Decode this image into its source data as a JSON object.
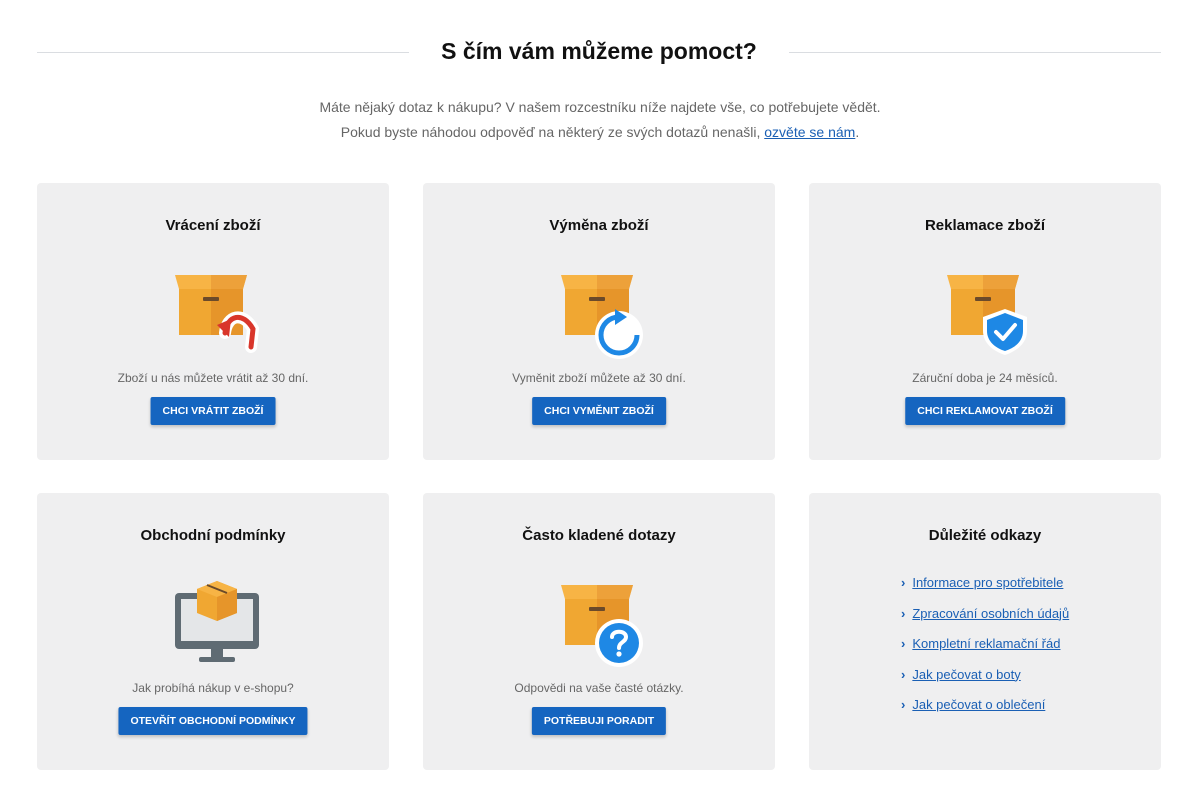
{
  "header": {
    "title": "S čím vám můžeme pomoct?"
  },
  "intro": {
    "line1": "Máte nějaký dotaz k nákupu? V našem rozcestníku níže najdete vše, co potřebujete vědět.",
    "line2_prefix": "Pokud byste náhodou odpověď na některý ze svých dotazů nenašli,",
    "line2_link": "ozvěte se nám",
    "line2_suffix": "."
  },
  "cards": [
    {
      "title": "Vrácení zboží",
      "text": "Zboží u nás můžete vrátit až 30 dní.",
      "button": "Chci vrátit zboží",
      "icon": "box-return-icon"
    },
    {
      "title": "Výměna zboží",
      "text": "Vyměnit zboží můžete až 30 dní.",
      "button": "Chci vyměnit zboží",
      "icon": "box-exchange-icon"
    },
    {
      "title": "Reklamace zboží",
      "text": "Záruční doba je 24 měsíců.",
      "button": "Chci reklamovat zboží",
      "icon": "box-shield-icon"
    },
    {
      "title": "Obchodní podmínky",
      "text": "Jak probíhá nákup v e-shopu?",
      "button": "Otevřít obchodní podmínky",
      "icon": "monitor-box-icon"
    },
    {
      "title": "Často kladené dotazy",
      "text": "Odpovědi na vaše časté otázky.",
      "button": "Potřebuji poradit",
      "icon": "box-question-icon"
    }
  ],
  "links_card": {
    "title": "Důležité odkazy",
    "items": [
      "Informace pro spotřebitele",
      "Zpracování osobních údajů",
      "Kompletní reklamační řád",
      "Jak pečovat o boty",
      "Jak pečovat o oblečení"
    ]
  },
  "colors": {
    "button": "#1565c0",
    "link": "#1a5fb4",
    "card_bg": "#efeff0",
    "box_orange": "#f5a623",
    "return_arrow": "#d9362b",
    "blue_badge": "#1e88e5"
  }
}
